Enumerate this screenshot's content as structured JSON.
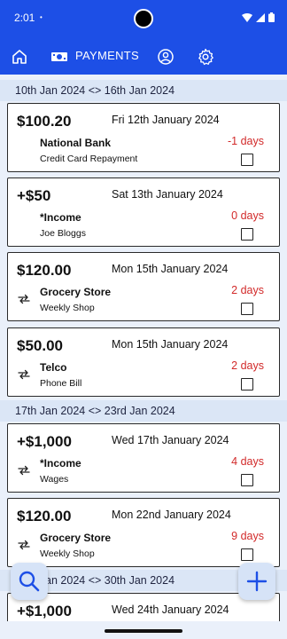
{
  "status_bar": {
    "time": "2:01",
    "notification_dot": "•"
  },
  "top_bar": {
    "active_tab": "PAYMENTS",
    "icons": [
      "home-icon",
      "payments-icon",
      "account-icon",
      "settings-icon"
    ]
  },
  "colors": {
    "primary": "#1d4fe6",
    "overdue": "#d22a2a",
    "background": "#eaf0fa",
    "week_header": "#dbe6f6"
  },
  "weeks": [
    {
      "label": "10th Jan 2024 <> 16th Jan 2024"
    },
    {
      "label": "17th Jan 2024 <> 23rd Jan 2024"
    },
    {
      "label": "24th Jan 2024 <> 30th Jan 2024"
    }
  ],
  "payments": [
    {
      "amount": "$100.20",
      "date": "Fri 12th January 2024",
      "payee": "National Bank",
      "memo": "Credit Card Repayment",
      "days": "-1 days",
      "recurring": false,
      "checked": false
    },
    {
      "amount": "+$50",
      "date": "Sat 13th January 2024",
      "payee": "*Income",
      "memo": "Joe Bloggs",
      "days": "0 days",
      "recurring": false,
      "checked": false
    },
    {
      "amount": "$120.00",
      "date": "Mon 15th January 2024",
      "payee": "Grocery Store",
      "memo": "Weekly Shop",
      "days": "2 days",
      "recurring": true,
      "checked": false
    },
    {
      "amount": "$50.00",
      "date": "Mon 15th January 2024",
      "payee": "Telco",
      "memo": "Phone Bill",
      "days": "2 days",
      "recurring": true,
      "checked": false
    },
    {
      "amount": "+$1,000",
      "date": "Wed 17th January 2024",
      "payee": "*Income",
      "memo": "Wages",
      "days": "4 days",
      "recurring": true,
      "checked": false
    },
    {
      "amount": "$120.00",
      "date": "Mon 22nd January 2024",
      "payee": "Grocery Store",
      "memo": "Weekly Shop",
      "days": "9 days",
      "recurring": true,
      "checked": false
    },
    {
      "amount": "+$1,000",
      "date": "Wed 24th January 2024",
      "payee": "",
      "memo": "",
      "days": "",
      "recurring": false,
      "checked": false
    }
  ],
  "fabs": {
    "search": "search-icon",
    "add": "plus-icon"
  }
}
